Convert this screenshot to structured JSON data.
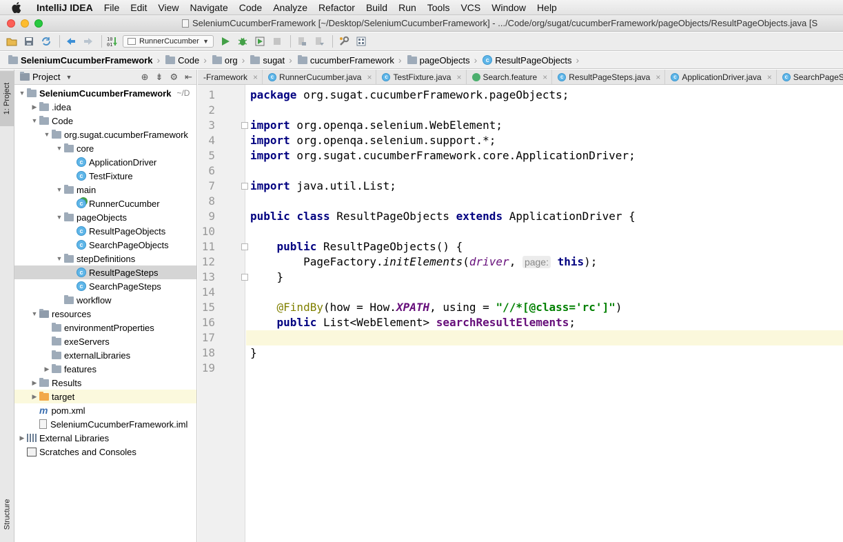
{
  "menubar": {
    "app_name": "IntelliJ IDEA",
    "items": [
      "File",
      "Edit",
      "View",
      "Navigate",
      "Code",
      "Analyze",
      "Refactor",
      "Build",
      "Run",
      "Tools",
      "VCS",
      "Window",
      "Help"
    ]
  },
  "window": {
    "title": "SeleniumCucumberFramework [~/Desktop/SeleniumCucumberFramework] - .../Code/org/sugat/cucumberFramework/pageObjects/ResultPageObjects.java [S"
  },
  "toolbar": {
    "run_config": "RunnerCucumber"
  },
  "breadcrumb": [
    {
      "label": "SeleniumCucumberFramework",
      "icon": "folder-icon"
    },
    {
      "label": "Code",
      "icon": "folder-icon"
    },
    {
      "label": "org",
      "icon": "folder-icon"
    },
    {
      "label": "sugat",
      "icon": "folder-icon"
    },
    {
      "label": "cucumberFramework",
      "icon": "folder-icon"
    },
    {
      "label": "pageObjects",
      "icon": "folder-icon"
    },
    {
      "label": "ResultPageObjects",
      "icon": "class-icon"
    }
  ],
  "left_strip": {
    "project_tab": "1: Project",
    "structure_tab": "Structure"
  },
  "project_panel": {
    "title": "Project",
    "tree": [
      {
        "label": "SeleniumCucumberFramework",
        "suffix": "~/D",
        "icon": "folder-icon",
        "arrow": "open",
        "depth": 0,
        "bold": true
      },
      {
        "label": ".idea",
        "icon": "folder-icon",
        "arrow": "closed",
        "depth": 1
      },
      {
        "label": "Code",
        "icon": "folder-icon",
        "arrow": "open",
        "depth": 1
      },
      {
        "label": "org.sugat.cucumberFramework",
        "icon": "package-icon",
        "arrow": "open",
        "depth": 2
      },
      {
        "label": "core",
        "icon": "package-icon",
        "arrow": "open",
        "depth": 3
      },
      {
        "label": "ApplicationDriver",
        "icon": "class-icon",
        "arrow": "none",
        "depth": 4
      },
      {
        "label": "TestFixture",
        "icon": "class-icon",
        "arrow": "none",
        "depth": 4
      },
      {
        "label": "main",
        "icon": "package-icon",
        "arrow": "open",
        "depth": 3
      },
      {
        "label": "RunnerCucumber",
        "icon": "runnable-class-icon",
        "arrow": "none",
        "depth": 4
      },
      {
        "label": "pageObjects",
        "icon": "package-icon",
        "arrow": "open",
        "depth": 3
      },
      {
        "label": "ResultPageObjects",
        "icon": "class-icon",
        "arrow": "none",
        "depth": 4
      },
      {
        "label": "SearchPageObjects",
        "icon": "class-icon",
        "arrow": "none",
        "depth": 4
      },
      {
        "label": "stepDefinitions",
        "icon": "package-icon",
        "arrow": "open",
        "depth": 3
      },
      {
        "label": "ResultPageSteps",
        "icon": "class-icon",
        "arrow": "none",
        "depth": 4,
        "selected": true
      },
      {
        "label": "SearchPageSteps",
        "icon": "class-icon",
        "arrow": "none",
        "depth": 4
      },
      {
        "label": "workflow",
        "icon": "package-icon",
        "arrow": "none",
        "depth": 3
      },
      {
        "label": "resources",
        "icon": "resources-folder-icon",
        "arrow": "open",
        "depth": 1
      },
      {
        "label": "environmentProperties",
        "icon": "folder-icon",
        "arrow": "none",
        "depth": 2
      },
      {
        "label": "exeServers",
        "icon": "folder-icon",
        "arrow": "none",
        "depth": 2
      },
      {
        "label": "externalLibraries",
        "icon": "folder-icon",
        "arrow": "none",
        "depth": 2
      },
      {
        "label": "features",
        "icon": "folder-icon",
        "arrow": "closed",
        "depth": 2
      },
      {
        "label": "Results",
        "icon": "folder-icon",
        "arrow": "closed",
        "depth": 1
      },
      {
        "label": "target",
        "icon": "orange-folder-icon",
        "arrow": "closed",
        "depth": 1,
        "highlight": true
      },
      {
        "label": "pom.xml",
        "icon": "maven-icon",
        "arrow": "none",
        "depth": 1
      },
      {
        "label": "SeleniumCucumberFramework.iml",
        "icon": "iml-file-icon",
        "arrow": "none",
        "depth": 1
      },
      {
        "label": "External Libraries",
        "icon": "libraries-icon",
        "arrow": "closed",
        "depth": 0
      },
      {
        "label": "Scratches and Consoles",
        "icon": "scratches-icon",
        "arrow": "none",
        "depth": 0
      }
    ]
  },
  "editor_tabs": [
    {
      "label": "-Framework",
      "icon": "none"
    },
    {
      "label": "RunnerCucumber.java",
      "icon": "class-icon"
    },
    {
      "label": "TestFixture.java",
      "icon": "class-icon"
    },
    {
      "label": "Search.feature",
      "icon": "feature-icon"
    },
    {
      "label": "ResultPageSteps.java",
      "icon": "class-icon"
    },
    {
      "label": "ApplicationDriver.java",
      "icon": "class-icon"
    },
    {
      "label": "SearchPageSteps",
      "icon": "class-icon"
    }
  ],
  "editor": {
    "line_numbers": [
      "1",
      "2",
      "3",
      "4",
      "5",
      "6",
      "7",
      "8",
      "9",
      "10",
      "11",
      "12",
      "13",
      "14",
      "15",
      "16",
      "17",
      "18",
      "19"
    ],
    "current_line": 17,
    "lines": [
      [
        {
          "t": "package",
          "c": "kw"
        },
        {
          "t": " org.sugat.cucumberFramework.pageObjects;"
        }
      ],
      [],
      [
        {
          "t": "import",
          "c": "kw"
        },
        {
          "t": " org.openqa.selenium.WebElement;"
        }
      ],
      [
        {
          "t": "import",
          "c": "kw"
        },
        {
          "t": " org.openqa.selenium.support.*;"
        }
      ],
      [
        {
          "t": "import",
          "c": "kw"
        },
        {
          "t": " org.sugat.cucumberFramework.core.ApplicationDriver;"
        }
      ],
      [],
      [
        {
          "t": "import",
          "c": "kw"
        },
        {
          "t": " java.util.List;"
        }
      ],
      [],
      [
        {
          "t": "public",
          "c": "kw"
        },
        {
          "t": " "
        },
        {
          "t": "class",
          "c": "kw"
        },
        {
          "t": " ResultPageObjects "
        },
        {
          "t": "extends",
          "c": "kw"
        },
        {
          "t": " ApplicationDriver {"
        }
      ],
      [],
      [
        {
          "t": "    "
        },
        {
          "t": "public",
          "c": "kw"
        },
        {
          "t": " ResultPageObjects() {"
        }
      ],
      [
        {
          "t": "        PageFactory."
        },
        {
          "t": "initElements",
          "c": "ital"
        },
        {
          "t": "("
        },
        {
          "t": "driver",
          "c": "param"
        },
        {
          "t": ", "
        },
        {
          "t": "page:",
          "c": "hint"
        },
        {
          "t": " "
        },
        {
          "t": "this",
          "c": "kw"
        },
        {
          "t": ");"
        }
      ],
      [
        {
          "t": "    }"
        }
      ],
      [],
      [
        {
          "t": "    "
        },
        {
          "t": "@FindBy",
          "c": "ann"
        },
        {
          "t": "(how = How."
        },
        {
          "t": "XPATH",
          "c": "stat"
        },
        {
          "t": ", using = "
        },
        {
          "t": "\"//*[@class='rc']\"",
          "c": "str"
        },
        {
          "t": ")"
        }
      ],
      [
        {
          "t": "    "
        },
        {
          "t": "public",
          "c": "kw"
        },
        {
          "t": " List<WebElement> "
        },
        {
          "t": "searchResultElements",
          "c": "fld"
        },
        {
          "t": ";"
        }
      ],
      [],
      [
        {
          "t": "}"
        }
      ],
      []
    ]
  },
  "colors": {
    "keyword": "#000080",
    "annotation": "#808000",
    "string": "#008000",
    "field": "#660e7a",
    "current_line": "#fbf8dc",
    "class_icon": "#5fb6e8"
  }
}
